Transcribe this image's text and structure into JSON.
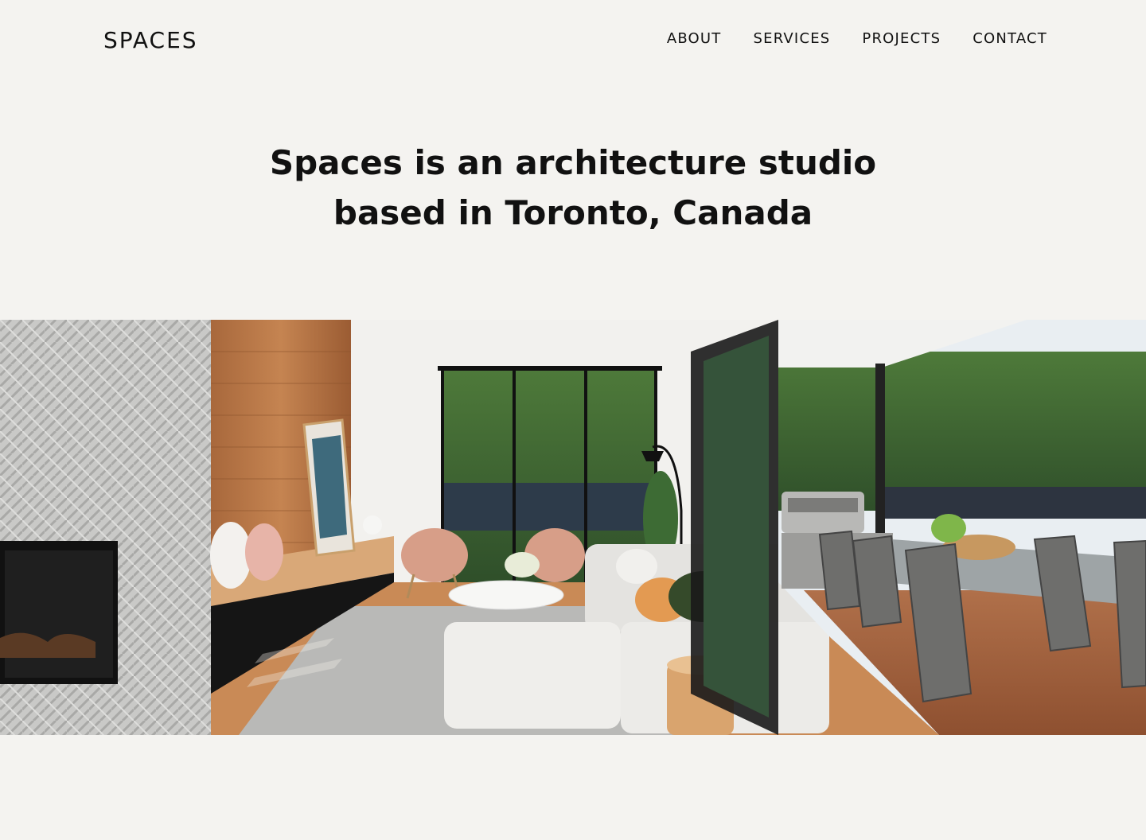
{
  "header": {
    "logo": "SPACES",
    "nav": [
      {
        "label": "ABOUT"
      },
      {
        "label": "SERVICES"
      },
      {
        "label": "PROJECTS"
      },
      {
        "label": "CONTACT"
      }
    ]
  },
  "hero": {
    "title_line1": "Spaces is an architecture studio",
    "title_line2": "based in Toronto, Canada"
  },
  "colors": {
    "background": "#f4f3f0",
    "text": "#111111"
  }
}
